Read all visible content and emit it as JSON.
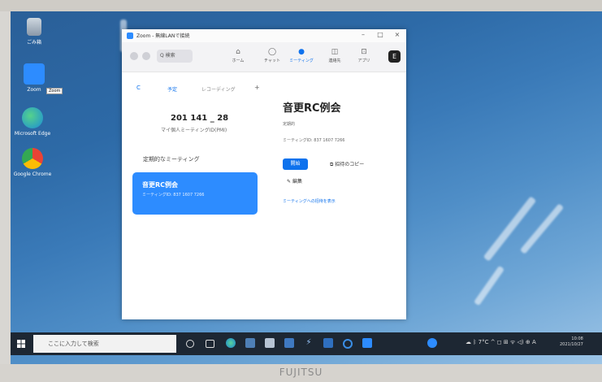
{
  "brand": "FUJITSU",
  "desktop_icons": [
    {
      "label": "ごみ箱"
    },
    {
      "label": "Zoom"
    },
    {
      "label": "Microsoft Edge"
    },
    {
      "label": "Google Chrome"
    }
  ],
  "tooltip": "Zoom",
  "window": {
    "title": "Zoom - 無線LANで接続",
    "minimize": "–",
    "maximize": "□",
    "close": "×"
  },
  "toolbar": {
    "search": "Q 検索",
    "tabs": [
      {
        "label": "ホーム",
        "icon": "⌂"
      },
      {
        "label": "チャット",
        "icon": "◯"
      },
      {
        "label": "ミーティング",
        "icon": "●"
      },
      {
        "label": "連絡先",
        "icon": "◫"
      },
      {
        "label": "アプリ",
        "icon": "⊡"
      }
    ],
    "avatar": "E"
  },
  "meetings_pane": {
    "refresh_icon": "C",
    "tabs": [
      "予定",
      "レコーディング"
    ],
    "add_icon": "+",
    "pmi_number": "201 141 _ 28",
    "pmi_label": "マイ個人ミーティングID(PMI)",
    "recurring_heading": "定期的なミーティング",
    "card_title": "音更RC例会",
    "card_id": "ミーティングID: 837 1607 7266"
  },
  "detail": {
    "title": "音更RC例会",
    "kind": "定期的",
    "meeting_id": "ミーティングID: 837 1607 7266",
    "start": "開始",
    "copy_invite": "招待のコピー",
    "edit": "編集",
    "show_invite": "ミーティングへの招待を表示"
  },
  "taskbar": {
    "search_placeholder": "ここに入力して検索",
    "tray_text": "☁ ᛒ 7°C  ^ ◻ ⊞ ᯤ ◁) ⊕ A",
    "time": "10:08",
    "date": "2021/10/27"
  }
}
